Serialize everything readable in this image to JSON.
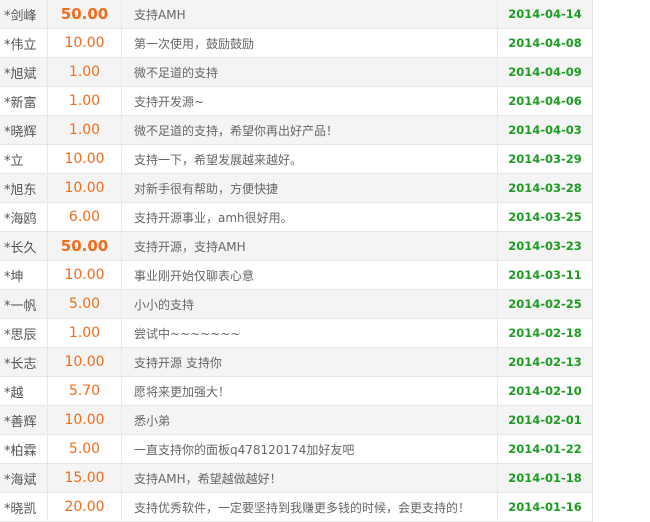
{
  "donations": [
    {
      "name": "*剑峰",
      "amount": "50.00",
      "message": "支持AMH",
      "date": "2014-04-14"
    },
    {
      "name": "*伟立",
      "amount": "10.00",
      "message": "第一次使用，鼓励鼓励",
      "date": "2014-04-08"
    },
    {
      "name": "*旭斌",
      "amount": "1.00",
      "message": "微不足道的支持",
      "date": "2014-04-09"
    },
    {
      "name": "*新富",
      "amount": "1.00",
      "message": "支持开发源~",
      "date": "2014-04-06"
    },
    {
      "name": "*晓辉",
      "amount": "1.00",
      "message": "微不足道的支持，希望你再出好产品！",
      "date": "2014-04-03"
    },
    {
      "name": "*立",
      "amount": "10.00",
      "message": "支持一下，希望发展越来越好。",
      "date": "2014-03-29"
    },
    {
      "name": "*旭东",
      "amount": "10.00",
      "message": "对新手很有帮助，方便快捷",
      "date": "2014-03-28"
    },
    {
      "name": "*海鸥",
      "amount": "6.00",
      "message": "支持开源事业，amh很好用。",
      "date": "2014-03-25"
    },
    {
      "name": "*长久",
      "amount": "50.00",
      "message": "支持开源，支持AMH",
      "date": "2014-03-23"
    },
    {
      "name": "*坤",
      "amount": "10.00",
      "message": "事业刚开始仅聊表心意",
      "date": "2014-03-11"
    },
    {
      "name": "*一帆",
      "amount": "5.00",
      "message": "小小的支持",
      "date": "2014-02-25"
    },
    {
      "name": "*思辰",
      "amount": "1.00",
      "message": "尝试中~~~~~~~",
      "date": "2014-02-18"
    },
    {
      "name": "*长志",
      "amount": "10.00",
      "message": "支持开源 支持你",
      "date": "2014-02-13"
    },
    {
      "name": "*越",
      "amount": "5.70",
      "message": "愿将来更加强大！",
      "date": "2014-02-10"
    },
    {
      "name": "*善辉",
      "amount": "10.00",
      "message": "悉小弟",
      "date": "2014-02-01"
    },
    {
      "name": "*柏霖",
      "amount": "5.00",
      "message": "一直支持你的面板q478120174加好友吧",
      "date": "2014-01-22"
    },
    {
      "name": "*海斌",
      "amount": "15.00",
      "message": "支持AMH，希望越做越好！",
      "date": "2014-01-18"
    },
    {
      "name": "*晓凯",
      "amount": "20.00",
      "message": "支持优秀软件，一定要坚持到我赚更多钱的时候，会更支持的！",
      "date": "2014-01-16"
    }
  ],
  "colors": {
    "amount": "#f16c1b",
    "date": "#1b9c22",
    "row_alt": "#f4f4f4"
  }
}
